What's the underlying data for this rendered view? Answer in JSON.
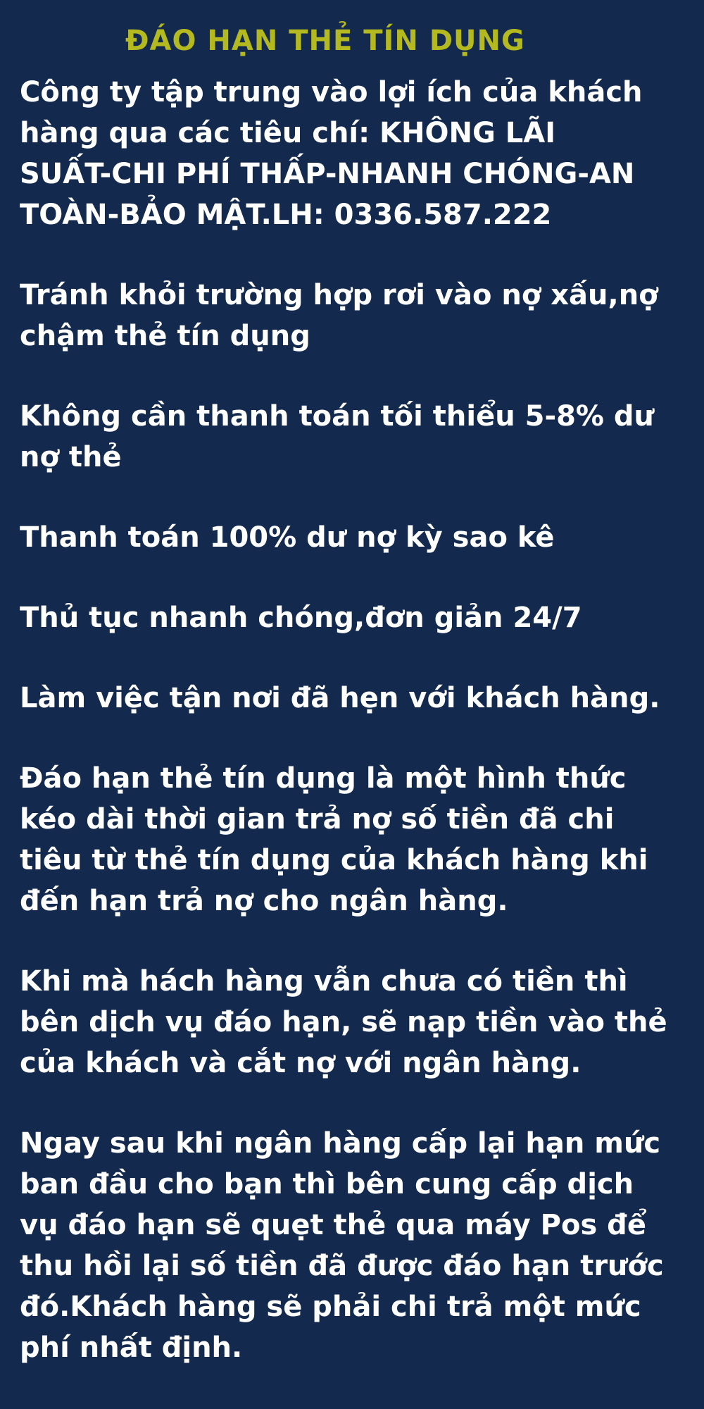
{
  "title": "ĐÁO HẠN THẺ TÍN DỤNG",
  "paragraphs": [
    {
      "lines": [
        "Công ty tập trung vào lợi ích của khách",
        "hàng qua các tiêu chí: KHÔNG LÃI",
        "SUẤT-CHI PHÍ THẤP-NHANH CHÓNG-AN",
        "TOÀN-BẢO MẬT.LH: 0336.587.222"
      ]
    },
    {
      "lines": [
        "Tránh khỏi trường hợp rơi vào nợ xấu,nợ",
        "chậm thẻ tín dụng"
      ]
    },
    {
      "lines": [
        "Không cần thanh toán tối thiểu 5-8% dư",
        "nợ thẻ"
      ]
    },
    {
      "lines": [
        "Thanh toán 100% dư nợ kỳ sao kê"
      ]
    },
    {
      "lines": [
        "Thủ tục nhanh chóng,đơn giản 24/7"
      ]
    },
    {
      "lines": [
        "Làm việc tận nơi đã hẹn với khách hàng."
      ]
    },
    {
      "lines": [
        "Đáo hạn thẻ tín dụng là một hình thức",
        "kéo dài thời gian trả nợ số tiền đã chi",
        "tiêu từ thẻ tín dụng của khách hàng khi",
        "đến hạn trả nợ cho ngân hàng."
      ]
    },
    {
      "lines": [
        "Khi mà hách hàng vẫn chưa có tiền thì",
        "bên dịch vụ đáo hạn, sẽ nạp tiền vào thẻ",
        "của khách và cắt nợ với ngân hàng."
      ]
    },
    {
      "lines": [
        "Ngay sau khi ngân hàng cấp lại hạn mức",
        "ban đầu cho bạn thì bên cung cấp dịch",
        "vụ đáo hạn sẽ quẹt thẻ qua máy Pos để",
        "thu hồi lại số tiền đã được đáo hạn trước",
        "đó.Khách hàng sẽ phải chi trả một mức",
        "phí nhất định."
      ]
    }
  ]
}
